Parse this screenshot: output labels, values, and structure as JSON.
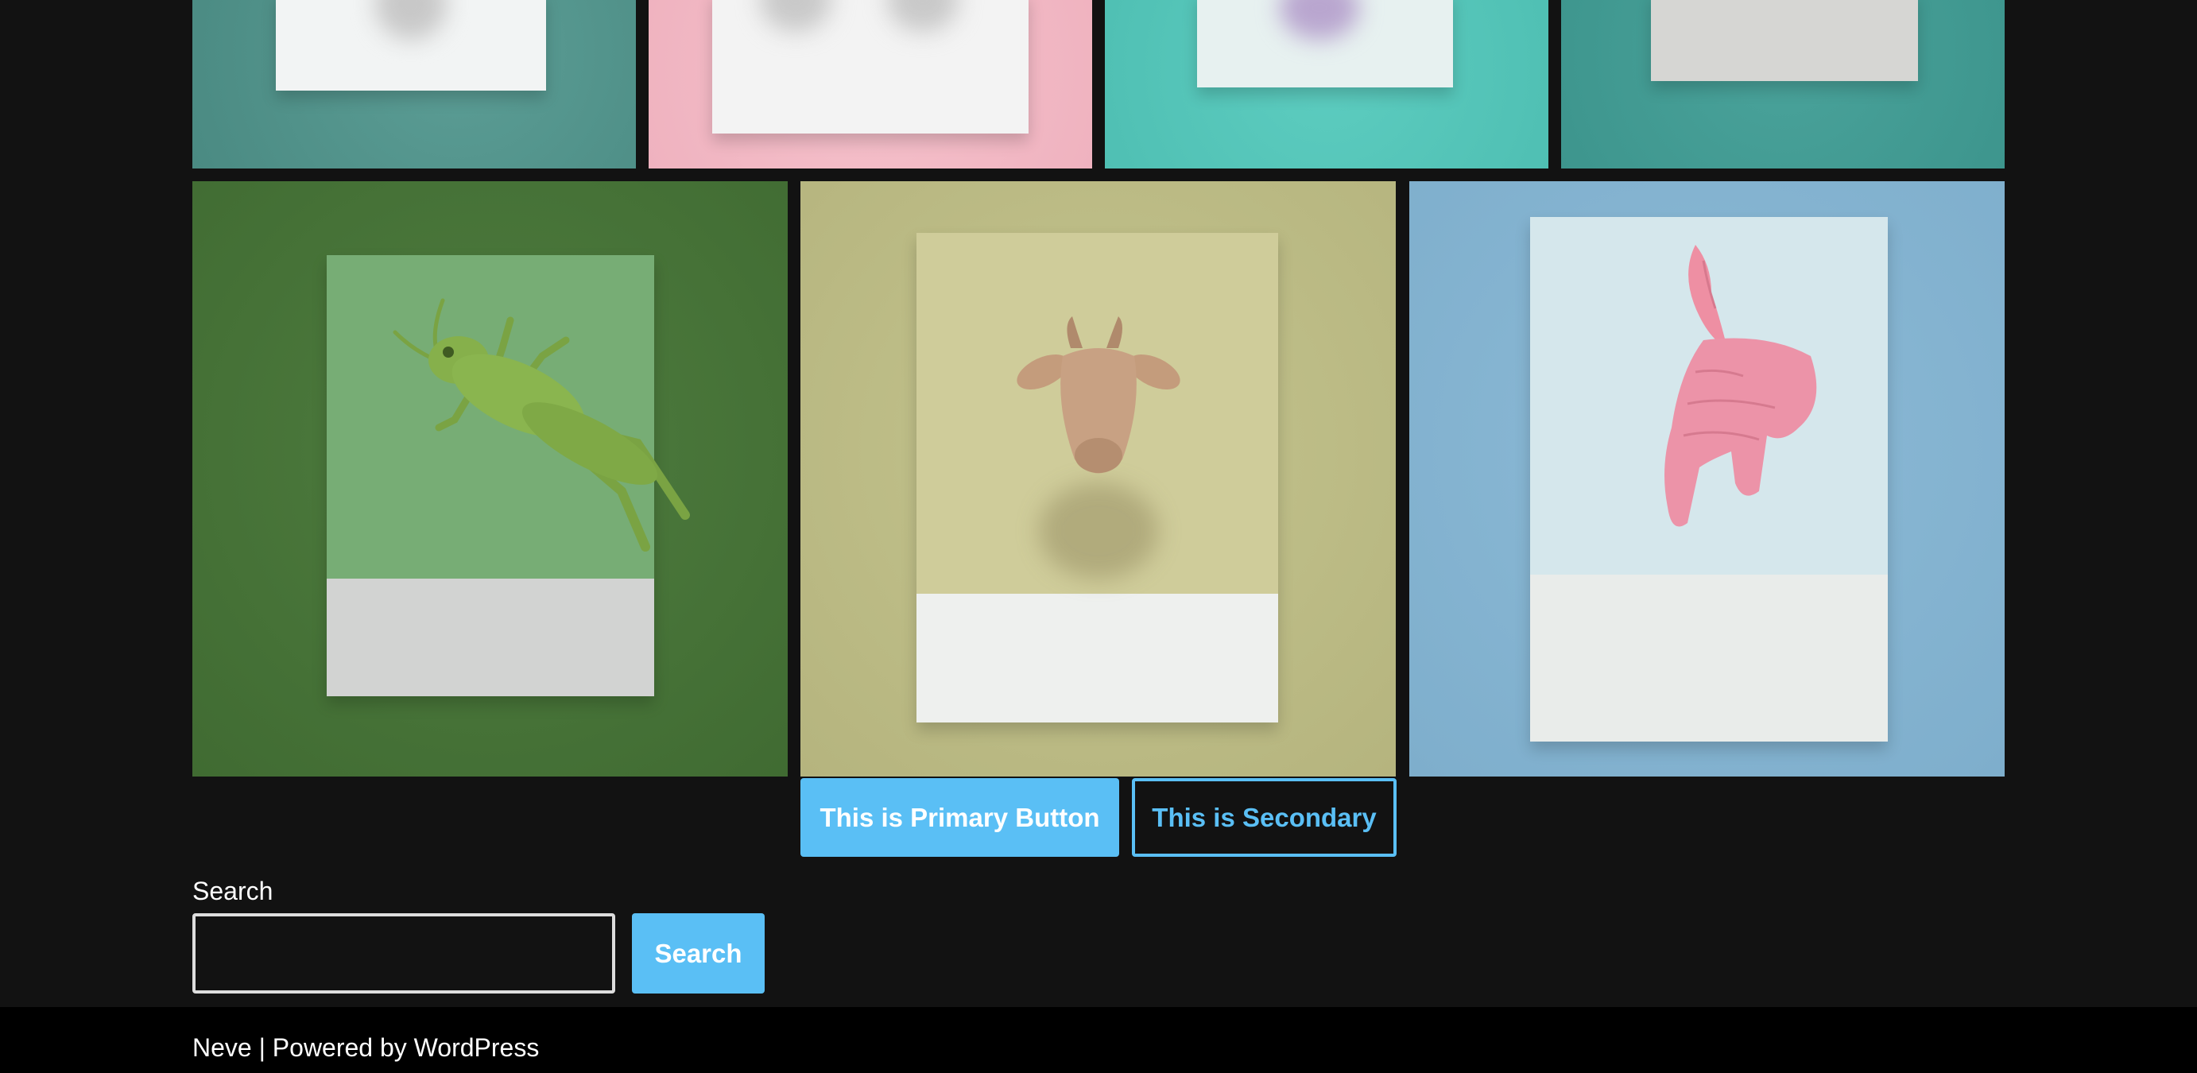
{
  "gallery": {
    "top_row": [
      {
        "image": "teal-tile-paper-card"
      },
      {
        "image": "pink-tile-paper-card"
      },
      {
        "image": "turquoise-tile-paper-card"
      },
      {
        "image": "teal-tile-paper-card-2"
      }
    ],
    "bottom_row": [
      {
        "image": "green-grasshopper-toy-on-card"
      },
      {
        "image": "goat-head-toy-on-card"
      },
      {
        "image": "pink-animal-toy-on-card"
      }
    ]
  },
  "buttons": {
    "primary_label": "This is Primary Button",
    "secondary_label": "This is Secondary"
  },
  "search": {
    "label": "Search",
    "value": "",
    "placeholder": "",
    "button_label": "Search"
  },
  "footer": {
    "text": "Neve | Powered by WordPress"
  },
  "colors": {
    "background": "#121212",
    "accent": "#5abff5",
    "footer_background": "#000000"
  }
}
